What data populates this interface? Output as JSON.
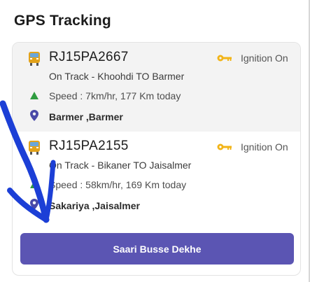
{
  "header": {
    "title": "GPS Tracking"
  },
  "vehicles": [
    {
      "reg_no": "RJ15PA2667",
      "ignition": "Ignition On",
      "route": "On Track - Khoohdi TO Barmer",
      "speed": "Speed : 7km/hr, 177 Km today",
      "location": "Barmer ,Barmer"
    },
    {
      "reg_no": "RJ15PA2155",
      "ignition": "Ignition On",
      "route": "On Track - Bikaner TO Jaisalmer",
      "speed": "Speed : 58km/hr, 169 Km today",
      "location": "Sakariya ,Jaisalmer"
    }
  ],
  "cta": {
    "label": "Saari Busse Dekhe"
  },
  "colors": {
    "accent": "#5b55b3",
    "ignition_key": "#f2b417",
    "speed_up": "#2e9c3f",
    "pin": "#4a4aa8",
    "bus": "#e2a21a",
    "annotation_scribble": "#1c3fd6"
  },
  "icons": [
    "bus-icon",
    "key-icon",
    "speed-up-arrow-icon",
    "location-pin-icon"
  ]
}
